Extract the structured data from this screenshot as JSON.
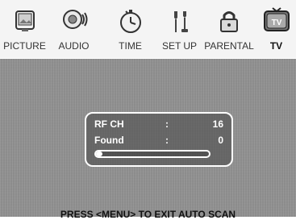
{
  "menu": {
    "tabs": [
      {
        "label": "PICTURE",
        "icon": "picture-icon"
      },
      {
        "label": "AUDIO",
        "icon": "audio-icon"
      },
      {
        "label": "TIME",
        "icon": "time-icon"
      },
      {
        "label": "SET UP",
        "icon": "setup-icon"
      },
      {
        "label": "PARENTAL",
        "icon": "parental-icon"
      },
      {
        "label": "TV",
        "icon": "tv-icon",
        "active": true
      }
    ]
  },
  "scan": {
    "rf_ch_label": "RF CH",
    "rf_ch_sep": ":",
    "rf_ch_value": "16",
    "found_label": "Found",
    "found_sep": ":",
    "found_value": "0",
    "progress_fraction": 0.06
  },
  "footer": {
    "hint": "PRESS <MENU> TO EXIT AUTO SCAN"
  },
  "colors": {
    "background": "#8a8a8a",
    "panel_border": "#ffffff",
    "text_on_screen": "#ffffff"
  }
}
